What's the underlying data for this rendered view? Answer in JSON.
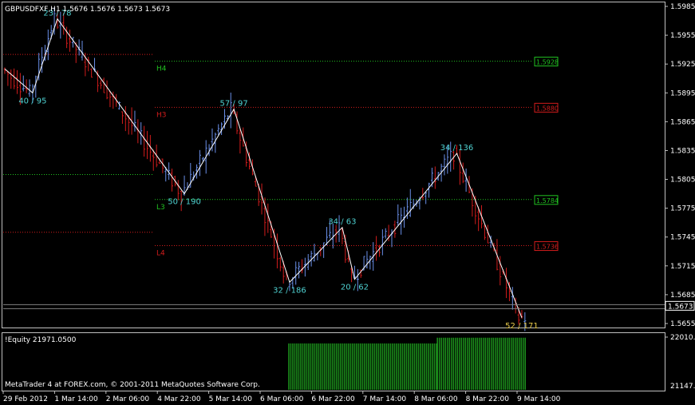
{
  "header": {
    "title": "GBPUSDFXF,H1  1.5676 1.5676 1.5673 1.5673"
  },
  "colors": {
    "bg": "#000000",
    "frame": "#c0c0c0",
    "bull": "#6a8fe8",
    "bear": "#d21c1c",
    "zigzag": "#ffffff",
    "zz_label": "#4fd2d2",
    "last_zz_label": "#e7c94a",
    "support": "#20c020",
    "resistance": "#d21c1c",
    "equity": "#1a8a1a"
  },
  "price_axis": {
    "ticks": [
      "1.5985",
      "1.5955",
      "1.5925",
      "1.5895",
      "1.5865",
      "1.5835",
      "1.5805",
      "1.5775",
      "1.5745",
      "1.5715",
      "1.5685",
      "1.5655"
    ],
    "current_price": "1.5673",
    "ymax": 1.5985,
    "ymin": 1.5655
  },
  "levels": [
    {
      "name": "H4",
      "value": 1.5928,
      "label": "1.5928",
      "kind": "support",
      "x_start_frac": 0.285
    },
    {
      "name": "H3",
      "value": 1.588,
      "label": "1.5880",
      "kind": "resistance",
      "x_start_frac": 0.285
    },
    {
      "name": "L3",
      "value": 1.5784,
      "label": "1.5784",
      "kind": "support",
      "x_start_frac": 0.285
    },
    {
      "name": "L4",
      "value": 1.5736,
      "label": "1.5736",
      "kind": "resistance",
      "x_start_frac": 0.285
    }
  ],
  "prev_levels": [
    {
      "value": 1.5935,
      "kind": "resistance"
    },
    {
      "value": 1.581,
      "kind": "support"
    },
    {
      "value": 1.575,
      "kind": "resistance"
    }
  ],
  "chart_data": {
    "type": "ohlc-bar",
    "symbol": "GBPUSDFXF",
    "timeframe": "H1",
    "x_labels": [
      "29 Feb 2012",
      "1 Mar 14:00",
      "2 Mar 06:00",
      "4 Mar 22:00",
      "5 Mar 14:00",
      "6 Mar 06:00",
      "6 Mar 22:00",
      "7 Mar 14:00",
      "8 Mar 06:00",
      "8 Mar 22:00",
      "9 Mar 14:00"
    ],
    "zigzag": [
      {
        "bar": 0,
        "price": 1.592
      },
      {
        "bar": 9,
        "price": 1.5895,
        "label": "40 / 95"
      },
      {
        "bar": 17,
        "price": 1.5972,
        "label": "23 / 78"
      },
      {
        "bar": 58,
        "price": 1.579,
        "label": "50 / 190"
      },
      {
        "bar": 74,
        "price": 1.5878,
        "label": "57 / 97"
      },
      {
        "bar": 92,
        "price": 1.5698,
        "label": "32 / 186"
      },
      {
        "bar": 109,
        "price": 1.5755,
        "label": "34 / 63"
      },
      {
        "bar": 113,
        "price": 1.5701,
        "label": "20 / 62"
      },
      {
        "bar": 146,
        "price": 1.5832,
        "label": "34 / 136"
      },
      {
        "bar": 167,
        "price": 1.5661,
        "label": "52 / 171"
      }
    ],
    "total_bars": 170
  },
  "equity": {
    "label": "!Equity 21971.0500",
    "axis_top": "22010.28",
    "axis_bottom": "21147.24",
    "ymax": 22010.28,
    "ymin": 21147.24,
    "segments": [
      {
        "from_bar": 92,
        "to_bar": 139,
        "value": 21900
      },
      {
        "from_bar": 140,
        "to_bar": 168,
        "value": 22000
      }
    ]
  },
  "footer": {
    "copyright": "MetaTrader 4 at FOREX.com, © 2001-2011 MetaQuotes Software Corp."
  }
}
